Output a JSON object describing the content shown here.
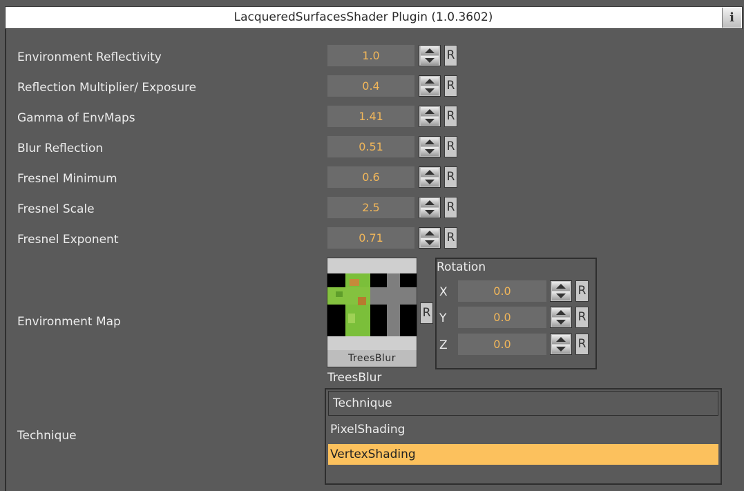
{
  "title": "LacqueredSurfacesShader Plugin (1.0.3602)",
  "info_label": "i",
  "reset_label": "R",
  "properties": [
    {
      "label": "Environment Reflectivity",
      "value": "1.0"
    },
    {
      "label": "Reflection Multiplier/ Exposure",
      "value": "0.4"
    },
    {
      "label": "Gamma of EnvMaps",
      "value": "1.41"
    },
    {
      "label": "Blur Reflection",
      "value": "0.51"
    },
    {
      "label": "Fresnel Minimum",
      "value": "0.6"
    },
    {
      "label": "Fresnel Scale",
      "value": "2.5"
    },
    {
      "label": "Fresnel Exponent",
      "value": "0.71"
    }
  ],
  "environment_map": {
    "label": "Environment Map",
    "thumbnail_caption": "TreesBlur",
    "texture_name": "TreesBlur",
    "rotation": {
      "title": "Rotation",
      "axes": [
        {
          "axis": "X",
          "value": "0.0"
        },
        {
          "axis": "Y",
          "value": "0.0"
        },
        {
          "axis": "Z",
          "value": "0.0"
        }
      ]
    }
  },
  "technique": {
    "label": "Technique",
    "header": "Technique",
    "options": [
      "PixelShading",
      "VertexShading"
    ],
    "selected": "VertexShading"
  },
  "colors": {
    "background": "#5a5a5a",
    "value_text": "#f2b75a",
    "selection": "#fcc15d"
  }
}
